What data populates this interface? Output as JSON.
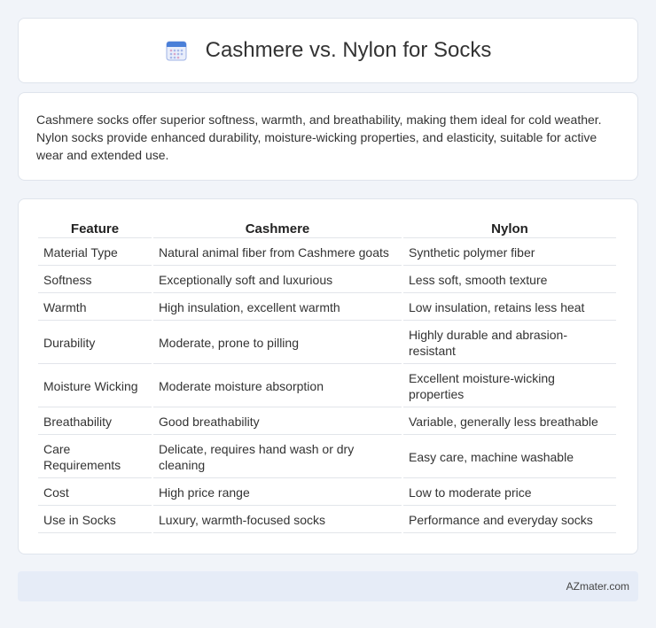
{
  "header": {
    "title": "Cashmere vs. Nylon for Socks",
    "icon": "calendar-icon"
  },
  "summary": {
    "text": "Cashmere socks offer superior softness, warmth, and breathability, making them ideal for cold weather. Nylon socks provide enhanced durability, moisture-wicking properties, and elasticity, suitable for active wear and extended use."
  },
  "table": {
    "headers": [
      "Feature",
      "Cashmere",
      "Nylon"
    ],
    "rows": [
      [
        "Material Type",
        "Natural animal fiber from Cashmere goats",
        "Synthetic polymer fiber"
      ],
      [
        "Softness",
        "Exceptionally soft and luxurious",
        "Less soft, smooth texture"
      ],
      [
        "Warmth",
        "High insulation, excellent warmth",
        "Low insulation, retains less heat"
      ],
      [
        "Durability",
        "Moderate, prone to pilling",
        "Highly durable and abrasion-resistant"
      ],
      [
        "Moisture Wicking",
        "Moderate moisture absorption",
        "Excellent moisture-wicking properties"
      ],
      [
        "Breathability",
        "Good breathability",
        "Variable, generally less breathable"
      ],
      [
        "Care Requirements",
        "Delicate, requires hand wash or dry cleaning",
        "Easy care, machine washable"
      ],
      [
        "Cost",
        "High price range",
        "Low to moderate price"
      ],
      [
        "Use in Socks",
        "Luxury, warmth-focused socks",
        "Performance and everyday socks"
      ]
    ]
  },
  "footer": {
    "text": "AZmater.com"
  },
  "colors": {
    "background": "#f1f4f9",
    "card": "#ffffff",
    "footer": "#e6ecf7",
    "icon_accent": "#4a7fd8"
  }
}
